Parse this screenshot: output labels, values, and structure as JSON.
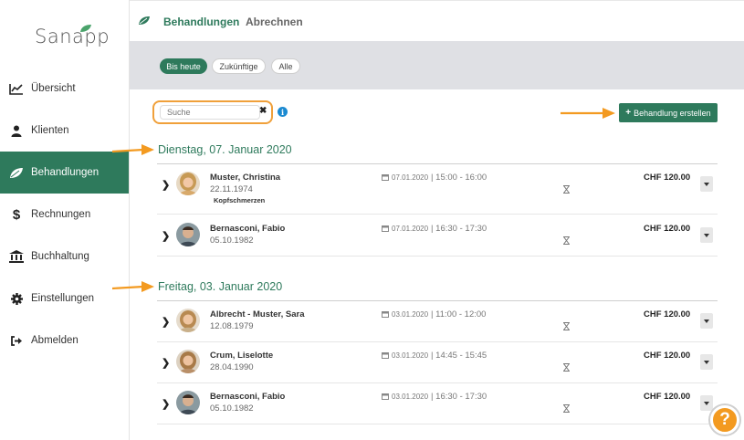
{
  "app": {
    "logo": "Sanapp"
  },
  "sidebar": {
    "items": [
      {
        "label": "Übersicht",
        "icon": "chart-line-icon"
      },
      {
        "label": "Klienten",
        "icon": "user-icon"
      },
      {
        "label": "Behandlungen",
        "icon": "leaf-icon",
        "active": true
      },
      {
        "label": "Rechnungen",
        "icon": "dollar-icon"
      },
      {
        "label": "Buchhaltung",
        "icon": "bank-icon"
      },
      {
        "label": "Einstellungen",
        "icon": "gear-icon"
      },
      {
        "label": "Abmelden",
        "icon": "sign-out-icon"
      }
    ]
  },
  "header": {
    "tabs": [
      {
        "label": "Behandlungen",
        "active": true
      },
      {
        "label": "Abrechnen",
        "active": false
      }
    ]
  },
  "filters": [
    {
      "label": "Bis heute",
      "active": true
    },
    {
      "label": "Zukünftige",
      "active": false
    },
    {
      "label": "Alle",
      "active": false
    }
  ],
  "search": {
    "placeholder": "Suche",
    "clear": "✖"
  },
  "actions": {
    "create_label": "Behandlung erstellen",
    "create_prefix": "+"
  },
  "groups": [
    {
      "date_label": "Dienstag, 07. Januar 2020",
      "rows": [
        {
          "name": "Muster, Christina",
          "dob": "22.11.1974",
          "note": "Kopfschmerzen",
          "date": "07.01.2020",
          "time": "15:00 - 16:00",
          "price": "CHF 120.00"
        },
        {
          "name": "Bernasconi, Fabio",
          "dob": "05.10.1982",
          "note": "",
          "date": "07.01.2020",
          "time": "16:30 - 17:30",
          "price": "CHF 120.00"
        }
      ]
    },
    {
      "date_label": "Freitag, 03. Januar 2020",
      "rows": [
        {
          "name": "Albrecht - Muster, Sara",
          "dob": "12.08.1979",
          "note": "",
          "date": "03.01.2020",
          "time": "11:00 - 12:00",
          "price": "CHF 120.00"
        },
        {
          "name": "Crum, Liselotte",
          "dob": "28.04.1990",
          "note": "",
          "date": "03.01.2020",
          "time": "14:45 - 15:45",
          "price": "CHF 120.00"
        },
        {
          "name": "Bernasconi, Fabio",
          "dob": "05.10.1982",
          "note": "",
          "date": "03.01.2020",
          "time": "16:30 - 17:30",
          "price": "CHF 120.00"
        }
      ]
    }
  ],
  "help": {
    "label": "?"
  },
  "colors": {
    "brand": "#2e7a5c",
    "accent": "#f39a20",
    "info": "#1b8ad1"
  }
}
